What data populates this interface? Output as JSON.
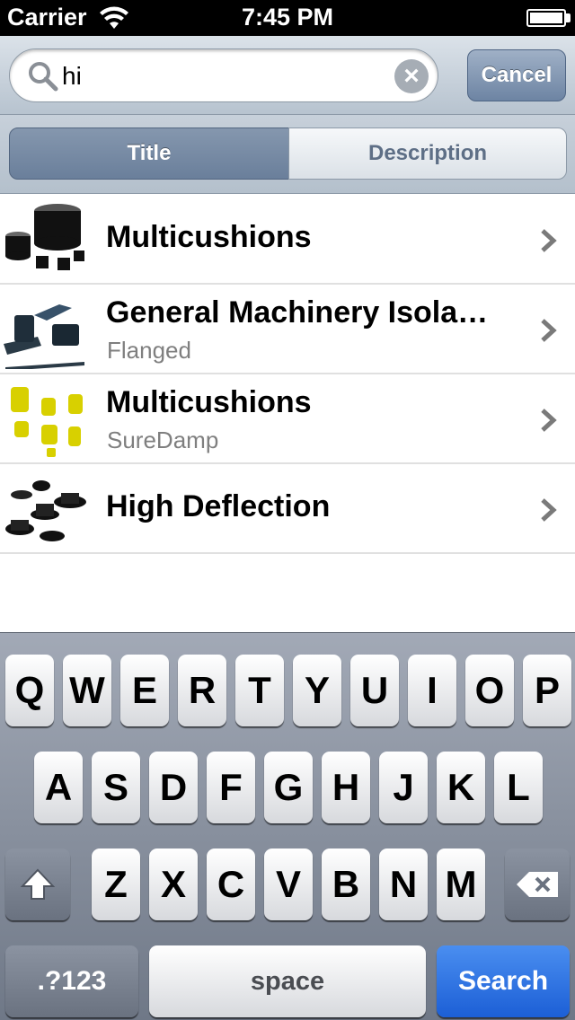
{
  "status_bar": {
    "carrier": "Carrier",
    "time": "7:45 PM"
  },
  "search": {
    "value": "hi",
    "cancel_label": "Cancel",
    "clear_icon": "×"
  },
  "scope": {
    "title_label": "Title",
    "description_label": "Description",
    "selected": "Title"
  },
  "results": [
    {
      "title": "Multicushions",
      "subtitle": ""
    },
    {
      "title": "General Machinery Isola…",
      "subtitle": "Flanged"
    },
    {
      "title": "Multicushions",
      "subtitle": "SureDamp"
    },
    {
      "title": "High Deflection",
      "subtitle": ""
    }
  ],
  "keyboard": {
    "row1": [
      "Q",
      "W",
      "E",
      "R",
      "T",
      "Y",
      "U",
      "I",
      "O",
      "P"
    ],
    "row2": [
      "A",
      "S",
      "D",
      "F",
      "G",
      "H",
      "J",
      "K",
      "L"
    ],
    "row3": [
      "Z",
      "X",
      "C",
      "V",
      "B",
      "N",
      "M"
    ],
    "numbers_label": ".?123",
    "space_label": "space",
    "search_label": "Search"
  },
  "colors": {
    "search_key": "#1c5fd6",
    "scope_selected": "#6a7f9b"
  }
}
